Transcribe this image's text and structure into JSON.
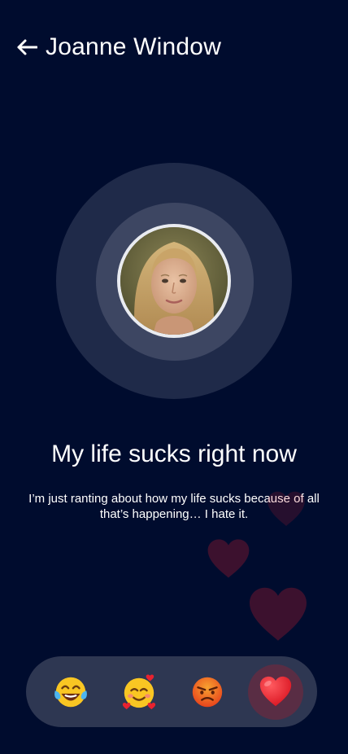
{
  "header": {
    "back_icon": "left-arrow-icon",
    "title": "Joanne Window"
  },
  "host": {
    "avatar": "avatar-photo"
  },
  "room": {
    "title": "My life sucks right now",
    "description": "I’m just ranting about how my life sucks because of all that’s happening… I hate it."
  },
  "reactions": [
    {
      "icon": "tears-of-joy-emoji-icon",
      "selected": false
    },
    {
      "icon": "smiling-face-with-hearts-emoji-icon",
      "selected": false
    },
    {
      "icon": "angry-face-emoji-icon",
      "selected": false
    },
    {
      "icon": "red-heart-emoji-icon",
      "selected": true
    }
  ],
  "floating_reactions": [
    "heart-icon",
    "heart-icon",
    "heart-icon"
  ],
  "colors": {
    "background": "#000c2e",
    "pulse_outer": "#1f2a49",
    "pulse_inner": "#3d4662",
    "reaction_bar": "#2e3752",
    "heart": "#e8222f"
  }
}
